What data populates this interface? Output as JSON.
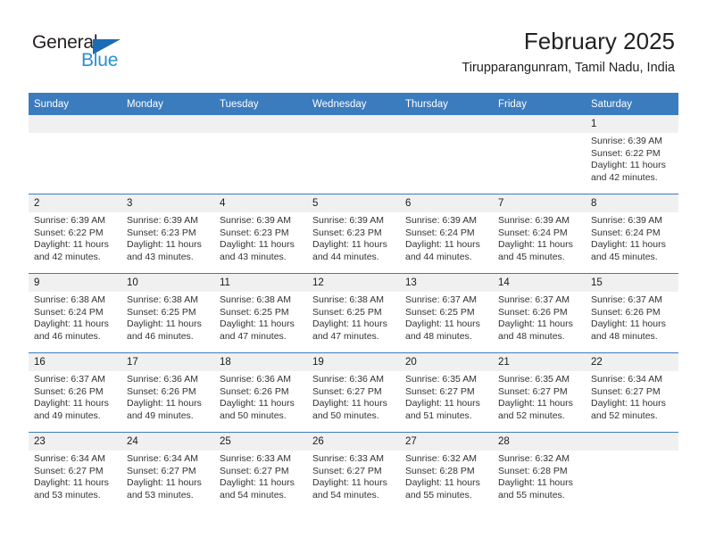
{
  "brand": {
    "name_part1": "General",
    "name_part2": "Blue",
    "triangle_color": "#1b6cb5",
    "blue_color": "#2a8fd4"
  },
  "header": {
    "month_title": "February 2025",
    "location": "Tirupparangunram, Tamil Nadu, India"
  },
  "theme": {
    "header_bar": "#3b7cbf",
    "daynum_bg": "#f0f0f0",
    "row_rule": "#3b7cbf"
  },
  "weekday_headers": [
    "Sunday",
    "Monday",
    "Tuesday",
    "Wednesday",
    "Thursday",
    "Friday",
    "Saturday"
  ],
  "weeks": [
    [
      {
        "day": "",
        "sunrise": "",
        "sunset": "",
        "daylight": "",
        "empty": true
      },
      {
        "day": "",
        "sunrise": "",
        "sunset": "",
        "daylight": "",
        "empty": true
      },
      {
        "day": "",
        "sunrise": "",
        "sunset": "",
        "daylight": "",
        "empty": true
      },
      {
        "day": "",
        "sunrise": "",
        "sunset": "",
        "daylight": "",
        "empty": true
      },
      {
        "day": "",
        "sunrise": "",
        "sunset": "",
        "daylight": "",
        "empty": true
      },
      {
        "day": "",
        "sunrise": "",
        "sunset": "",
        "daylight": "",
        "empty": true
      },
      {
        "day": "1",
        "sunrise": "Sunrise: 6:39 AM",
        "sunset": "Sunset: 6:22 PM",
        "daylight": "Daylight: 11 hours and 42 minutes.",
        "empty": false
      }
    ],
    [
      {
        "day": "2",
        "sunrise": "Sunrise: 6:39 AM",
        "sunset": "Sunset: 6:22 PM",
        "daylight": "Daylight: 11 hours and 42 minutes.",
        "empty": false
      },
      {
        "day": "3",
        "sunrise": "Sunrise: 6:39 AM",
        "sunset": "Sunset: 6:23 PM",
        "daylight": "Daylight: 11 hours and 43 minutes.",
        "empty": false
      },
      {
        "day": "4",
        "sunrise": "Sunrise: 6:39 AM",
        "sunset": "Sunset: 6:23 PM",
        "daylight": "Daylight: 11 hours and 43 minutes.",
        "empty": false
      },
      {
        "day": "5",
        "sunrise": "Sunrise: 6:39 AM",
        "sunset": "Sunset: 6:23 PM",
        "daylight": "Daylight: 11 hours and 44 minutes.",
        "empty": false
      },
      {
        "day": "6",
        "sunrise": "Sunrise: 6:39 AM",
        "sunset": "Sunset: 6:24 PM",
        "daylight": "Daylight: 11 hours and 44 minutes.",
        "empty": false
      },
      {
        "day": "7",
        "sunrise": "Sunrise: 6:39 AM",
        "sunset": "Sunset: 6:24 PM",
        "daylight": "Daylight: 11 hours and 45 minutes.",
        "empty": false
      },
      {
        "day": "8",
        "sunrise": "Sunrise: 6:39 AM",
        "sunset": "Sunset: 6:24 PM",
        "daylight": "Daylight: 11 hours and 45 minutes.",
        "empty": false
      }
    ],
    [
      {
        "day": "9",
        "sunrise": "Sunrise: 6:38 AM",
        "sunset": "Sunset: 6:24 PM",
        "daylight": "Daylight: 11 hours and 46 minutes.",
        "empty": false
      },
      {
        "day": "10",
        "sunrise": "Sunrise: 6:38 AM",
        "sunset": "Sunset: 6:25 PM",
        "daylight": "Daylight: 11 hours and 46 minutes.",
        "empty": false
      },
      {
        "day": "11",
        "sunrise": "Sunrise: 6:38 AM",
        "sunset": "Sunset: 6:25 PM",
        "daylight": "Daylight: 11 hours and 47 minutes.",
        "empty": false
      },
      {
        "day": "12",
        "sunrise": "Sunrise: 6:38 AM",
        "sunset": "Sunset: 6:25 PM",
        "daylight": "Daylight: 11 hours and 47 minutes.",
        "empty": false
      },
      {
        "day": "13",
        "sunrise": "Sunrise: 6:37 AM",
        "sunset": "Sunset: 6:25 PM",
        "daylight": "Daylight: 11 hours and 48 minutes.",
        "empty": false
      },
      {
        "day": "14",
        "sunrise": "Sunrise: 6:37 AM",
        "sunset": "Sunset: 6:26 PM",
        "daylight": "Daylight: 11 hours and 48 minutes.",
        "empty": false
      },
      {
        "day": "15",
        "sunrise": "Sunrise: 6:37 AM",
        "sunset": "Sunset: 6:26 PM",
        "daylight": "Daylight: 11 hours and 48 minutes.",
        "empty": false
      }
    ],
    [
      {
        "day": "16",
        "sunrise": "Sunrise: 6:37 AM",
        "sunset": "Sunset: 6:26 PM",
        "daylight": "Daylight: 11 hours and 49 minutes.",
        "empty": false
      },
      {
        "day": "17",
        "sunrise": "Sunrise: 6:36 AM",
        "sunset": "Sunset: 6:26 PM",
        "daylight": "Daylight: 11 hours and 49 minutes.",
        "empty": false
      },
      {
        "day": "18",
        "sunrise": "Sunrise: 6:36 AM",
        "sunset": "Sunset: 6:26 PM",
        "daylight": "Daylight: 11 hours and 50 minutes.",
        "empty": false
      },
      {
        "day": "19",
        "sunrise": "Sunrise: 6:36 AM",
        "sunset": "Sunset: 6:27 PM",
        "daylight": "Daylight: 11 hours and 50 minutes.",
        "empty": false
      },
      {
        "day": "20",
        "sunrise": "Sunrise: 6:35 AM",
        "sunset": "Sunset: 6:27 PM",
        "daylight": "Daylight: 11 hours and 51 minutes.",
        "empty": false
      },
      {
        "day": "21",
        "sunrise": "Sunrise: 6:35 AM",
        "sunset": "Sunset: 6:27 PM",
        "daylight": "Daylight: 11 hours and 52 minutes.",
        "empty": false
      },
      {
        "day": "22",
        "sunrise": "Sunrise: 6:34 AM",
        "sunset": "Sunset: 6:27 PM",
        "daylight": "Daylight: 11 hours and 52 minutes.",
        "empty": false
      }
    ],
    [
      {
        "day": "23",
        "sunrise": "Sunrise: 6:34 AM",
        "sunset": "Sunset: 6:27 PM",
        "daylight": "Daylight: 11 hours and 53 minutes.",
        "empty": false
      },
      {
        "day": "24",
        "sunrise": "Sunrise: 6:34 AM",
        "sunset": "Sunset: 6:27 PM",
        "daylight": "Daylight: 11 hours and 53 minutes.",
        "empty": false
      },
      {
        "day": "25",
        "sunrise": "Sunrise: 6:33 AM",
        "sunset": "Sunset: 6:27 PM",
        "daylight": "Daylight: 11 hours and 54 minutes.",
        "empty": false
      },
      {
        "day": "26",
        "sunrise": "Sunrise: 6:33 AM",
        "sunset": "Sunset: 6:27 PM",
        "daylight": "Daylight: 11 hours and 54 minutes.",
        "empty": false
      },
      {
        "day": "27",
        "sunrise": "Sunrise: 6:32 AM",
        "sunset": "Sunset: 6:28 PM",
        "daylight": "Daylight: 11 hours and 55 minutes.",
        "empty": false
      },
      {
        "day": "28",
        "sunrise": "Sunrise: 6:32 AM",
        "sunset": "Sunset: 6:28 PM",
        "daylight": "Daylight: 11 hours and 55 minutes.",
        "empty": false
      },
      {
        "day": "",
        "sunrise": "",
        "sunset": "",
        "daylight": "",
        "empty": true
      }
    ]
  ]
}
